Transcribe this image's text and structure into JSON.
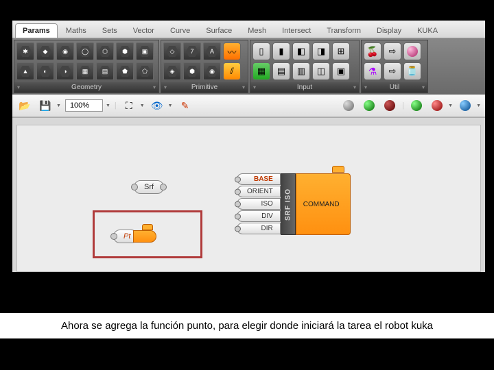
{
  "tabs": [
    "Params",
    "Maths",
    "Sets",
    "Vector",
    "Curve",
    "Surface",
    "Mesh",
    "Intersect",
    "Transform",
    "Display",
    "KUKA"
  ],
  "active_tab": "Params",
  "ribbon_groups": {
    "geometry": "Geometry",
    "primitive": "Primitive",
    "input": "Input",
    "util": "Util"
  },
  "zoom": "100%",
  "canvas": {
    "srf_node": "Srf",
    "pt_node": "Pt",
    "big_node": {
      "inputs": [
        "BASE",
        "ORIENT",
        "ISO",
        "DIV",
        "DIR"
      ],
      "name": "SRF ISO",
      "output": "COMMAND"
    }
  },
  "caption": "Ahora se agrega la función punto, para elegir donde iniciará la tarea el robot kuka"
}
